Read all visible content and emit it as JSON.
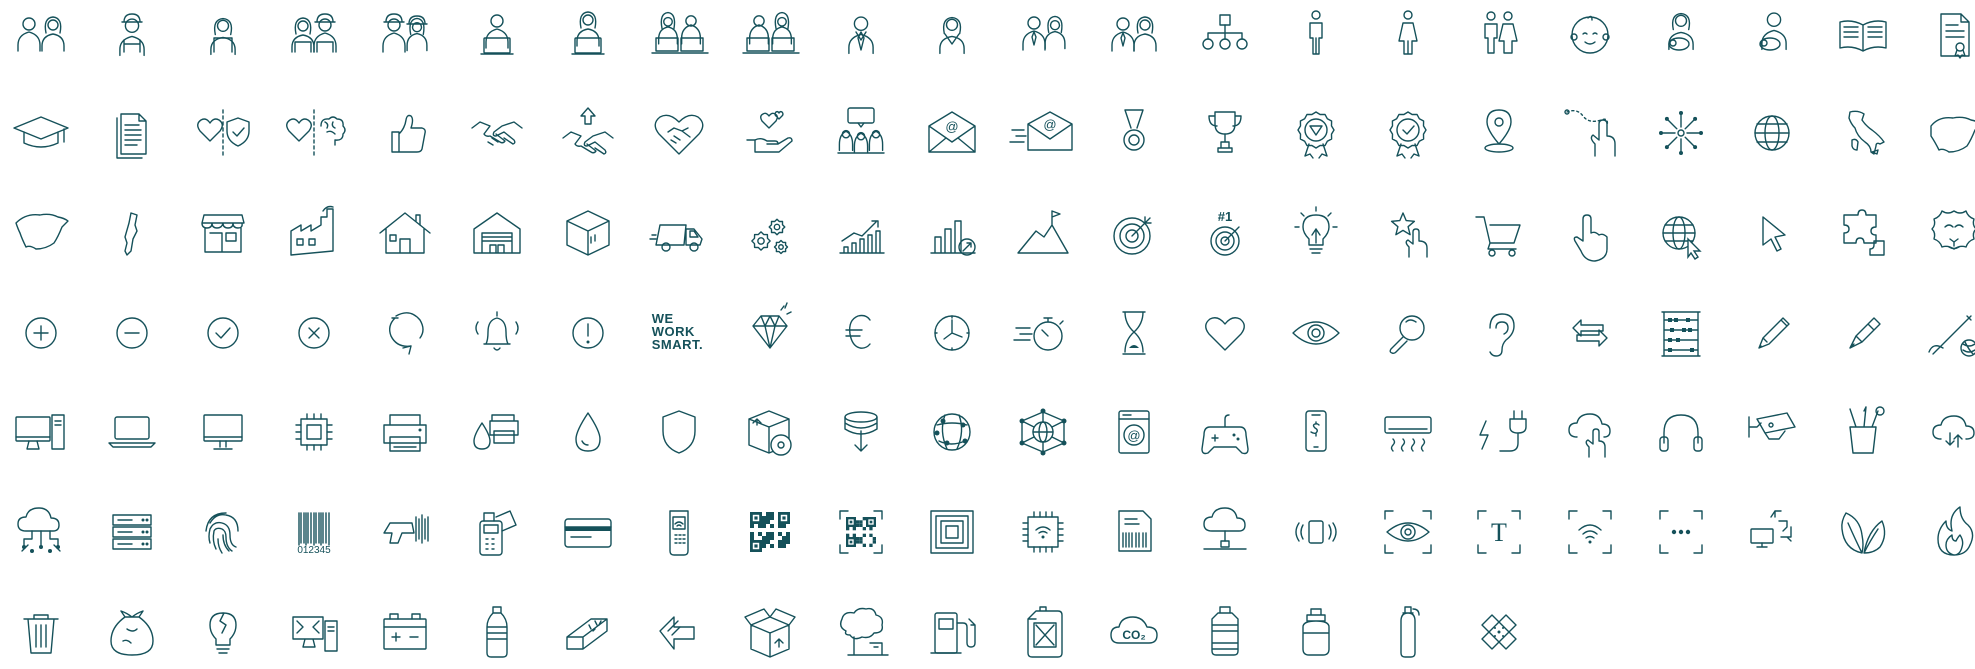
{
  "colors": {
    "stroke": "#15515a",
    "background": "#ffffff"
  },
  "icons": [
    [
      "couple-icon",
      "construction-worker-icon",
      "female-worker-icon",
      "worker-pair-icon",
      "helmet-workers-icon",
      "man-laptop-icon",
      "woman-laptop-icon",
      "laptop-pair-icon",
      "laptop-team-icon",
      "businessman-icon",
      "businesswoman-icon",
      "business-pair-icon",
      "team-pair-icon",
      "org-chart-icon",
      "man-icon",
      "woman-icon",
      "man-woman-icon",
      "baby-icon",
      "mother-baby-icon",
      "father-baby-icon",
      "open-book-icon",
      "certificate-document-icon"
    ],
    [
      "graduation-cap-icon",
      "documents-icon",
      "heart-shield-icon",
      "heart-brain-icon",
      "thumbs-up-icon",
      "handshake-icon",
      "handshake-growth-icon",
      "heart-handshake-icon",
      "caring-hand-icon",
      "meeting-icon",
      "email-envelope-icon",
      "fast-email-icon",
      "medal-icon",
      "trophy-icon",
      "quality-badge-icon",
      "check-badge-icon",
      "location-pin-icon",
      "route-touch-icon",
      "expand-arrows-icon",
      "globe-icon",
      "italy-map-icon",
      "spain-map-icon"
    ],
    [
      "iberia-map-icon",
      "portugal-map-icon",
      "shop-icon",
      "factory-icon",
      "house-icon",
      "warehouse-icon",
      "package-box-icon",
      "delivery-truck-icon",
      "gears-icon",
      "growth-chart-icon",
      "bar-chart-growth-icon",
      "mountain-flag-icon",
      "target-icon",
      "number-one-target-icon",
      "light-bulb-icon",
      "star-touch-icon",
      "shopping-cart-icon",
      "pointer-hand-icon",
      "globe-click-icon",
      "mouse-cursor-icon",
      "puzzle-icon",
      "lion-icon"
    ],
    [
      "plus-circle-icon",
      "minus-circle-icon",
      "check-circle-icon",
      "close-circle-icon",
      "refresh-icon",
      "bell-icon",
      "alert-circle-icon",
      "we-work-smart-logo",
      "diamond-icon",
      "euro-icon",
      "clock-icon",
      "stopwatch-speed-icon",
      "hourglass-icon",
      "heart-icon",
      "eye-icon",
      "magnifier-icon",
      "ear-icon",
      "exchange-arrows-icon",
      "abacus-icon",
      "pencil-icon",
      "pen-icon",
      "needle-thread-icon"
    ],
    [
      "desktop-computer-icon",
      "laptop-icon",
      "monitor-icon",
      "cpu-chip-icon",
      "printer-icon",
      "ink-printer-icon",
      "ink-drop-icon",
      "shield-icon",
      "disc-box-icon",
      "data-stack-icon",
      "network-globe-icon",
      "network-hub-icon",
      "washing-machine-icon",
      "gamepad-icon",
      "mobile-payment-icon",
      "air-conditioner-icon",
      "power-plug-icon",
      "cloud-touch-icon",
      "headphones-icon",
      "security-camera-icon",
      "stationery-icon",
      "cloud-sync-icon"
    ],
    [
      "cloud-network-icon",
      "server-rack-icon",
      "fingerprint-icon",
      "barcode-icon",
      "barcode-scanner-icon",
      "pos-terminal-icon",
      "credit-card-icon",
      "handheld-terminal-icon",
      "qr-code-icon",
      "qr-scan-icon",
      "rfid-tag-icon",
      "wifi-chip-icon",
      "barcode-label-icon",
      "cloud-connection-icon",
      "vibration-icon",
      "eye-scan-icon",
      "text-scan-icon",
      "wifi-scan-icon",
      "dots-scan-icon",
      "remote-device-icon",
      "leaves-icon",
      "flame-icon"
    ],
    [
      "trash-bin-icon",
      "garbage-bag-icon",
      "broken-bulb-icon",
      "electronic-waste-icon",
      "car-battery-icon",
      "plastic-bottle-icon",
      "metal-bar-icon",
      "cardboard-icon",
      "open-box-icon",
      "pollution-icon",
      "fuel-pump-icon",
      "jerrycan-icon",
      "co2-cloud-icon",
      "water-jug-icon",
      "gas-cylinder-icon",
      "oxygen-tank-icon",
      "bandage-icon"
    ]
  ],
  "brand": {
    "line1": "WE",
    "line2": "WORK",
    "line3": "SMART."
  },
  "badge": {
    "number": "#1"
  },
  "labels": {
    "co2": "CO₂",
    "barcode_digits": "012345",
    "text_scan": "T",
    "email_at": "@",
    "euro": "€"
  }
}
